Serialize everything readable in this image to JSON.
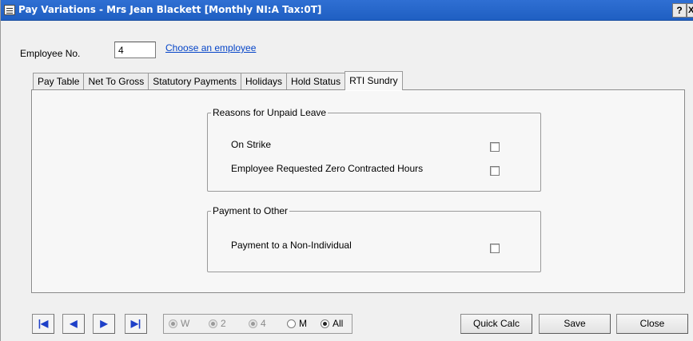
{
  "window": {
    "title": "Pay Variations - Mrs Jean Blackett   [Monthly NI:A Tax:0T]",
    "help_label": "?",
    "close_label": "X"
  },
  "employee": {
    "label": "Employee No.",
    "value": "4",
    "choose_link": "Choose an employee"
  },
  "tabs": [
    {
      "label": "Pay Table"
    },
    {
      "label": "Net To Gross"
    },
    {
      "label": "Statutory Payments"
    },
    {
      "label": "Holidays"
    },
    {
      "label": "Hold Status"
    },
    {
      "label": "RTI Sundry",
      "active": true
    }
  ],
  "unpaid_leave": {
    "legend": "Reasons for Unpaid Leave",
    "options": [
      {
        "label": "On Strike",
        "checked": false
      },
      {
        "label": "Employee Requested Zero Contracted Hours",
        "checked": false
      }
    ]
  },
  "payment_other": {
    "legend": "Payment to Other",
    "options": [
      {
        "label": "Payment to a Non-Individual",
        "checked": false
      }
    ]
  },
  "navigation": {
    "first": "|◀",
    "prev": "◀",
    "next": "▶",
    "last": "▶|"
  },
  "frequency": {
    "options": [
      {
        "label": "W",
        "enabled": false
      },
      {
        "label": "2",
        "enabled": false
      },
      {
        "label": "4",
        "enabled": false
      },
      {
        "label": "M",
        "enabled": true
      },
      {
        "label": "All",
        "enabled": true,
        "selected": true
      }
    ]
  },
  "buttons": {
    "quick_calc": "Quick Calc",
    "save": "Save",
    "close": "Close"
  },
  "colors": {
    "titlebar": "#1f5fc2",
    "link": "#0645c8"
  }
}
